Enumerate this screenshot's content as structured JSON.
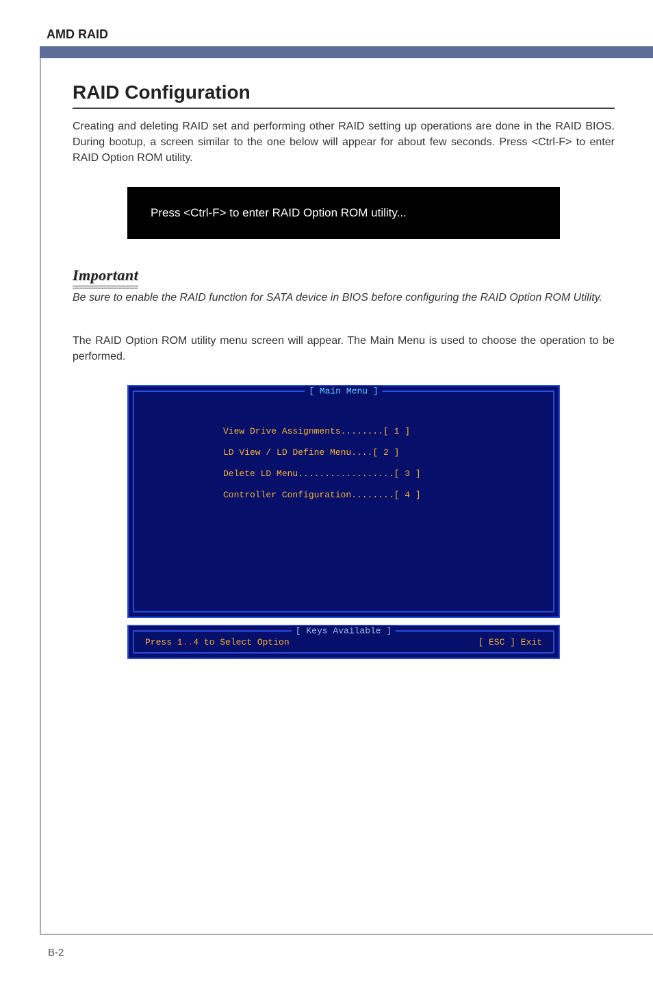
{
  "header": {
    "title": "AMD RAID"
  },
  "section": {
    "heading": "RAID Configuration",
    "intro": "Creating and deleting RAID set and performing other RAID setting up operations are done in the RAID BIOS. During bootup, a screen similar to the one below will appear for about few seconds. Press <Ctrl-F> to enter RAID Option ROM utility.",
    "prompt_box": "Press <Ctrl-F> to enter RAID Option ROM utility...",
    "important_label": "Important",
    "important_note": "Be sure to enable the RAID function for SATA device in BIOS before configuring the RAID Option ROM Utility.",
    "menu_intro": "The RAID Option ROM utility menu screen will appear. The Main Menu is used to choose the operation to be performed."
  },
  "bios": {
    "main_title": "[ Main Menu ]",
    "items": [
      "View Drive Assignments........[  1  ]",
      "LD View / LD Define Menu....[  2  ]",
      "Delete LD Menu..................[  3  ]",
      "Controller Configuration........[  4  ]"
    ],
    "keys_title": "[ Keys Available ]",
    "keys_left_prefix": "Press 1",
    "keys_left_dots": "..",
    "keys_left_suffix": "4 to Select Option",
    "keys_right": "[ ESC ]  Exit"
  },
  "footer": {
    "page": "B-2"
  }
}
